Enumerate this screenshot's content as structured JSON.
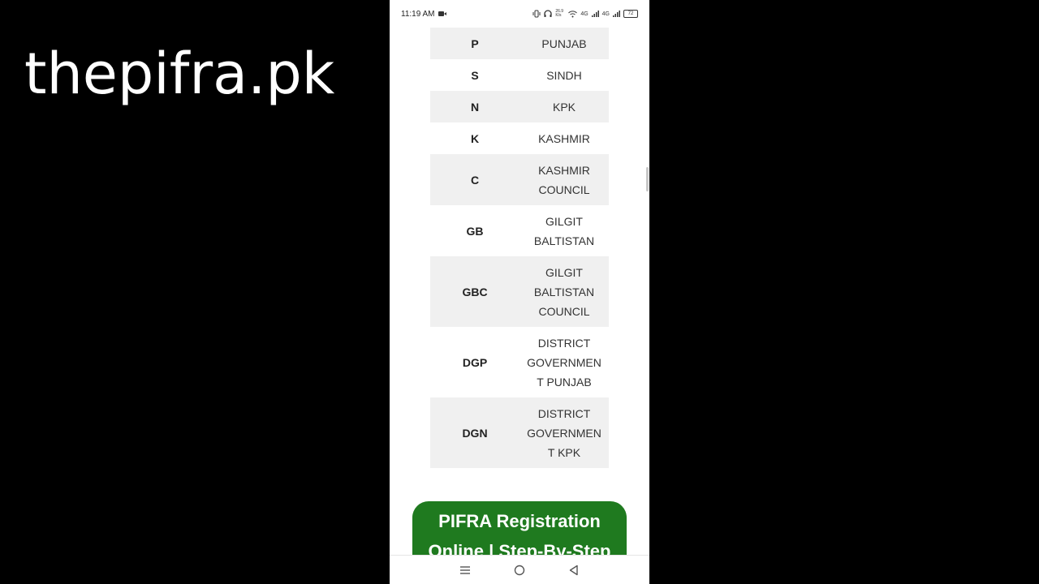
{
  "watermark": "thepifra.pk",
  "status_bar": {
    "time": "11:19 AM",
    "net_speed": "26.9 K/s",
    "sim1": "4G",
    "sim2": "4G",
    "battery": "72"
  },
  "table": {
    "rows": [
      {
        "code": "P",
        "name": [
          "PUNJAB"
        ]
      },
      {
        "code": "S",
        "name": [
          "SINDH"
        ]
      },
      {
        "code": "N",
        "name": [
          "KPK"
        ]
      },
      {
        "code": "K",
        "name": [
          "KASHMIR"
        ]
      },
      {
        "code": "C",
        "name": [
          "KASHMIR",
          "COUNCIL"
        ]
      },
      {
        "code": "GB",
        "name": [
          "GILGIT",
          "BALTISTAN"
        ]
      },
      {
        "code": "GBC",
        "name": [
          "GILGIT",
          "BALTISTAN",
          "COUNCIL"
        ]
      },
      {
        "code": "DGP",
        "name": [
          "DISTRICT",
          "GOVERNMEN",
          "T PUNJAB"
        ]
      },
      {
        "code": "DGN",
        "name": [
          "DISTRICT",
          "GOVERNMEN",
          "T KPK"
        ]
      }
    ]
  },
  "banner": {
    "line1": "PIFRA Registration",
    "line2": "Online | Step-By-Step"
  },
  "colors": {
    "banner_bg": "#1f7a1f",
    "row_shade": "#f0f0f0"
  },
  "icons": {
    "nav_menu": "menu-icon",
    "nav_home": "home-circle-icon",
    "nav_back": "back-triangle-icon"
  }
}
